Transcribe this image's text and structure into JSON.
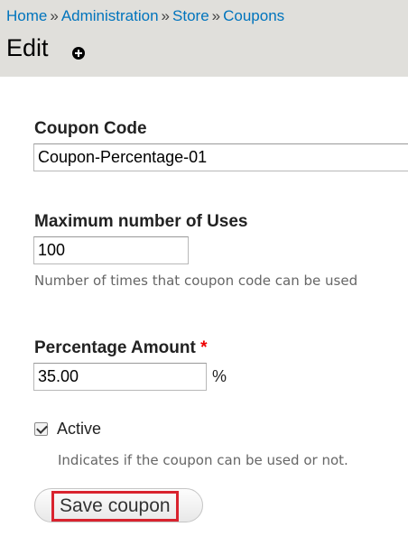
{
  "breadcrumb": {
    "items": [
      "Home",
      "Administration",
      "Store",
      "Coupons"
    ],
    "separator": "»"
  },
  "page": {
    "title": "Edit",
    "shortcut_icon": "plus-circle-icon"
  },
  "form": {
    "coupon_code": {
      "label": "Coupon Code",
      "value": "Coupon-Percentage-01"
    },
    "max_uses": {
      "label": "Maximum number of Uses",
      "value": "100",
      "description": "Number of times that coupon code can be used"
    },
    "percentage": {
      "label": "Percentage Amount",
      "required_marker": "*",
      "value": "35.00",
      "suffix": "%"
    },
    "active": {
      "label": "Active",
      "checked": true,
      "description": "Indicates if the coupon can be used or not."
    },
    "save_label": "Save coupon"
  },
  "colors": {
    "link": "#0074bd",
    "header_bg": "#e0dfdb",
    "required": "#ee0000",
    "highlight": "#d9232e"
  }
}
